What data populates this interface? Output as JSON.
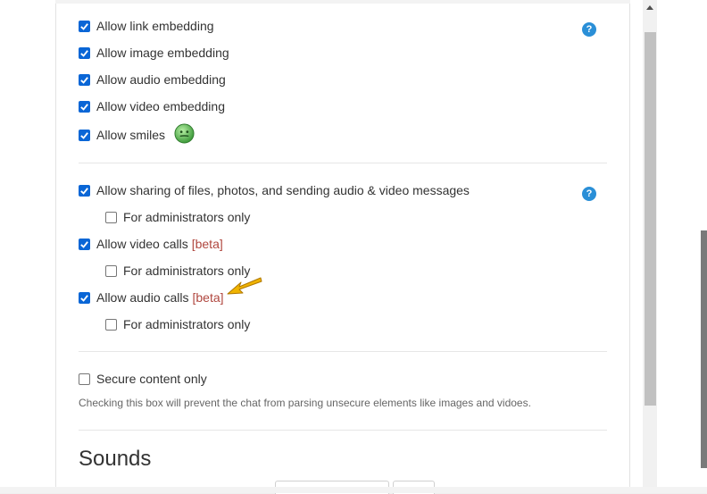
{
  "embedding": {
    "link_label": "Allow link embedding",
    "image_label": "Allow image embedding",
    "audio_label": "Allow audio embedding",
    "video_label": "Allow video embedding",
    "smiles_label": "Allow smiles"
  },
  "sharing": {
    "files_label": "Allow sharing of files, photos, and sending audio & video messages",
    "admins_only_label": "For administrators only",
    "video_calls_label": "Allow video calls",
    "audio_calls_label": "Allow audio calls",
    "beta_tag": "[beta]"
  },
  "secure": {
    "label": "Secure content only",
    "hint": "Checking this box will prevent the chat from parsing unsecure elements like images and vidoes."
  },
  "sounds": {
    "heading": "Sounds"
  },
  "help_glyph": "?",
  "colors": {
    "checkbox": "#0a66d6",
    "help": "#2a8fd7",
    "beta": "#b0473f",
    "arrow": "#f0b400"
  },
  "icons": [
    "help-icon",
    "smiley-icon",
    "arrow-pointer-icon",
    "scroll-up-icon"
  ]
}
